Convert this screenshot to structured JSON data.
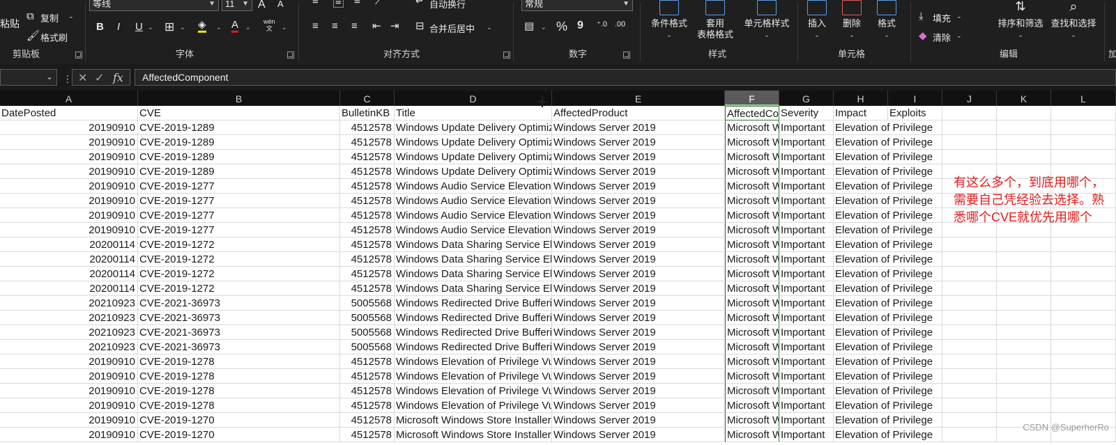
{
  "ribbon": {
    "clipboard": {
      "paste": "粘贴",
      "copy": "复制",
      "format_painter": "格式刷",
      "label": "剪贴板"
    },
    "font": {
      "name": "等线",
      "size": "11",
      "grow": "A",
      "shrink": "A",
      "bold": "B",
      "italic": "I",
      "underline": "U",
      "wen": "wén",
      "wen_char": "文",
      "label": "字体"
    },
    "alignment": {
      "wrap": "自动换行",
      "merge": "合并后居中",
      "label": "对齐方式"
    },
    "number": {
      "format": "常规",
      "percent": "%",
      "comma": "9",
      "label": "数字"
    },
    "styles": {
      "conditional": "条件格式",
      "table_line1": "套用",
      "table_line2": "表格格式",
      "cell_styles": "单元格样式",
      "label": "样式"
    },
    "cells": {
      "insert": "插入",
      "delete": "删除",
      "format": "格式",
      "label": "单元格"
    },
    "editing": {
      "fill": "填充",
      "clear": "清除",
      "sort": "排序和筛选",
      "find": "查找和选择",
      "label": "编辑",
      "extra": "加"
    }
  },
  "formula_bar": {
    "fx": "fx",
    "content": "AffectedComponent"
  },
  "columns": [
    "A",
    "B",
    "C",
    "D",
    "E",
    "F",
    "G",
    "H",
    "I",
    "J",
    "K",
    "L"
  ],
  "selected_column": "F",
  "header_row": [
    "DatePosted",
    "CVE",
    "BulletinKB",
    "Title",
    "AffectedProduct",
    "AffectedComponent",
    "Severity",
    "Impact",
    "Exploits"
  ],
  "rows": [
    [
      "20190910",
      "CVE-2019-1289",
      "4512578",
      "Windows Update Delivery Optimization",
      "Windows Server 2019",
      "Microsoft Windows",
      "Important",
      "Elevation of Privilege"
    ],
    [
      "20190910",
      "CVE-2019-1289",
      "4512578",
      "Windows Update Delivery Optimization",
      "Windows Server 2019",
      "Microsoft Windows",
      "Important",
      "Elevation of Privilege"
    ],
    [
      "20190910",
      "CVE-2019-1289",
      "4512578",
      "Windows Update Delivery Optimization",
      "Windows Server 2019",
      "Microsoft Windows",
      "Important",
      "Elevation of Privilege"
    ],
    [
      "20190910",
      "CVE-2019-1289",
      "4512578",
      "Windows Update Delivery Optimization",
      "Windows Server 2019",
      "Microsoft Windows",
      "Important",
      "Elevation of Privilege"
    ],
    [
      "20190910",
      "CVE-2019-1277",
      "4512578",
      "Windows Audio Service Elevation",
      "Windows Server 2019",
      "Microsoft Windows",
      "Important",
      "Elevation of Privilege"
    ],
    [
      "20190910",
      "CVE-2019-1277",
      "4512578",
      "Windows Audio Service Elevation",
      "Windows Server 2019",
      "Microsoft Windows",
      "Important",
      "Elevation of Privilege"
    ],
    [
      "20190910",
      "CVE-2019-1277",
      "4512578",
      "Windows Audio Service Elevation",
      "Windows Server 2019",
      "Microsoft Windows",
      "Important",
      "Elevation of Privilege"
    ],
    [
      "20190910",
      "CVE-2019-1277",
      "4512578",
      "Windows Audio Service Elevation",
      "Windows Server 2019",
      "Microsoft Windows",
      "Important",
      "Elevation of Privilege"
    ],
    [
      "20200114",
      "CVE-2019-1272",
      "4512578",
      "Windows Data Sharing Service Elevation",
      "Windows Server 2019",
      "Microsoft Windows",
      "Important",
      "Elevation of Privilege"
    ],
    [
      "20200114",
      "CVE-2019-1272",
      "4512578",
      "Windows Data Sharing Service Elevation",
      "Windows Server 2019",
      "Microsoft Windows",
      "Important",
      "Elevation of Privilege"
    ],
    [
      "20200114",
      "CVE-2019-1272",
      "4512578",
      "Windows Data Sharing Service Elevation",
      "Windows Server 2019",
      "Microsoft Windows",
      "Important",
      "Elevation of Privilege"
    ],
    [
      "20200114",
      "CVE-2019-1272",
      "4512578",
      "Windows Data Sharing Service Elevation",
      "Windows Server 2019",
      "Microsoft Windows",
      "Important",
      "Elevation of Privilege"
    ],
    [
      "20210923",
      "CVE-2021-36973",
      "5005568",
      "Windows Redirected Drive Buffering",
      "Windows Server 2019",
      "Microsoft Windows",
      "Important",
      "Elevation of Privilege"
    ],
    [
      "20210923",
      "CVE-2021-36973",
      "5005568",
      "Windows Redirected Drive Buffering",
      "Windows Server 2019",
      "Microsoft Windows",
      "Important",
      "Elevation of Privilege"
    ],
    [
      "20210923",
      "CVE-2021-36973",
      "5005568",
      "Windows Redirected Drive Buffering",
      "Windows Server 2019",
      "Microsoft Windows",
      "Important",
      "Elevation of Privilege"
    ],
    [
      "20210923",
      "CVE-2021-36973",
      "5005568",
      "Windows Redirected Drive Buffering",
      "Windows Server 2019",
      "Microsoft Windows",
      "Important",
      "Elevation of Privilege"
    ],
    [
      "20190910",
      "CVE-2019-1278",
      "4512578",
      "Windows Elevation of Privilege Vulnerability",
      "Windows Server 2019",
      "Microsoft Windows",
      "Important",
      "Elevation of Privilege"
    ],
    [
      "20190910",
      "CVE-2019-1278",
      "4512578",
      "Windows Elevation of Privilege Vulnerability",
      "Windows Server 2019",
      "Microsoft Windows",
      "Important",
      "Elevation of Privilege"
    ],
    [
      "20190910",
      "CVE-2019-1278",
      "4512578",
      "Windows Elevation of Privilege Vulnerability",
      "Windows Server 2019",
      "Microsoft Windows",
      "Important",
      "Elevation of Privilege"
    ],
    [
      "20190910",
      "CVE-2019-1278",
      "4512578",
      "Windows Elevation of Privilege Vulnerability",
      "Windows Server 2019",
      "Microsoft Windows",
      "Important",
      "Elevation of Privilege"
    ],
    [
      "20190910",
      "CVE-2019-1270",
      "4512578",
      "Microsoft Windows Store Installer",
      "Windows Server 2019",
      "Microsoft Windows",
      "Important",
      "Elevation of Privilege"
    ],
    [
      "20190910",
      "CVE-2019-1270",
      "4512578",
      "Microsoft Windows Store Installer",
      "Windows Server 2019",
      "Microsoft Windows",
      "Important",
      "Elevation of Privilege"
    ]
  ],
  "annotation": "有这么多个，到底用哪个，需要自己凭经验去选择。熟悉哪个CVE就优先用哪个",
  "watermark": "CSDN @SuperherRo",
  "colors": {
    "ribbon_bg": "#1f1f1f",
    "annotation": "#e31b1b",
    "selection": "#2e7d32"
  }
}
